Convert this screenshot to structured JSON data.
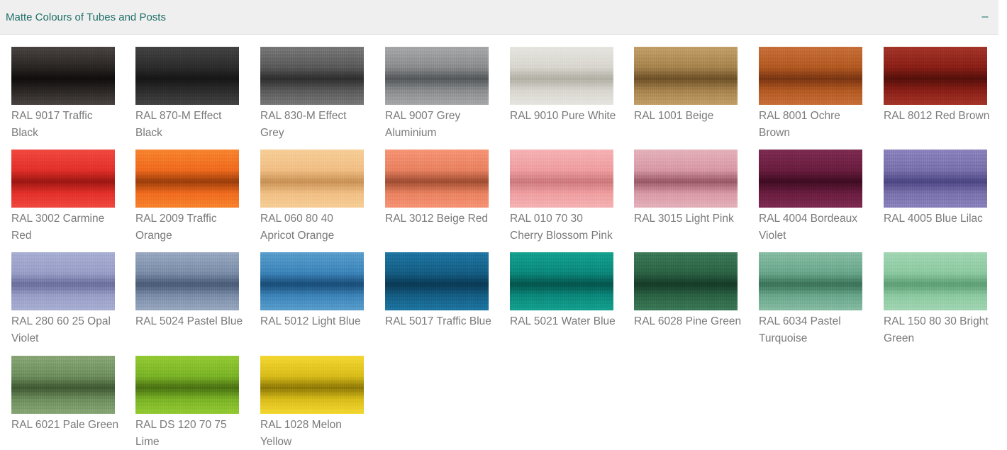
{
  "accordion": {
    "title": "Matte Colours of Tubes and Posts",
    "collapse_symbol": "–"
  },
  "swatches": [
    {
      "label": "RAL 9017 Traffic Black",
      "base": "#2a2624",
      "light": "#4a4542",
      "dark": "#100d0c",
      "icon": "color-swatch"
    },
    {
      "label": "RAL 870-M Effect Black",
      "base": "#2c2c2c",
      "light": "#444444",
      "dark": "#161616",
      "icon": "color-swatch"
    },
    {
      "label": "RAL 830-M Effect Grey",
      "base": "#5a5a5a",
      "light": "#7a7a7a",
      "dark": "#2e2e2e",
      "icon": "color-swatch"
    },
    {
      "label": "RAL 9007 Grey Aluminium",
      "base": "#8b8d8f",
      "light": "#a7a9ab",
      "dark": "#55585b",
      "icon": "color-swatch"
    },
    {
      "label": "RAL 9010 Pure White",
      "base": "#d8d6cf",
      "light": "#e6e5df",
      "dark": "#b3b0a5",
      "icon": "color-swatch"
    },
    {
      "label": "RAL 1001 Beige",
      "base": "#a7844e",
      "light": "#c3a06a",
      "dark": "#6e5127",
      "icon": "color-swatch"
    },
    {
      "label": "RAL 8001 Ochre Brown",
      "base": "#b35a22",
      "light": "#c8713a",
      "dark": "#7a3512",
      "icon": "color-swatch"
    },
    {
      "label": "RAL 8012 Red Brown",
      "base": "#8a1f16",
      "light": "#a5352a",
      "dark": "#55100b",
      "icon": "color-swatch"
    },
    {
      "label": "RAL 3002 Carmine Red",
      "base": "#e3302a",
      "light": "#f04a40",
      "dark": "#9d1712",
      "icon": "color-swatch"
    },
    {
      "label": "RAL 2009 Traffic Orange",
      "base": "#f06c1e",
      "light": "#f7862f",
      "dark": "#9c3e0b",
      "icon": "color-swatch"
    },
    {
      "label": "RAL 060 80 40 Apricot Orange",
      "base": "#f1bf86",
      "light": "#f6cf98",
      "dark": "#c99356",
      "icon": "color-swatch"
    },
    {
      "label": "RAL 3012 Beige Red",
      "base": "#e98361",
      "light": "#f69577",
      "dark": "#a04e33",
      "icon": "color-swatch"
    },
    {
      "label": "RAL 010 70 30 Cherry Blossom Pink",
      "base": "#ef9fa1",
      "light": "#f5b3b4",
      "dark": "#cd7b7e",
      "icon": "color-swatch"
    },
    {
      "label": "RAL 3015 Light Pink",
      "base": "#d89aa7",
      "light": "#e4b2bb",
      "dark": "#9a5b68",
      "icon": "color-swatch"
    },
    {
      "label": "RAL 4004 Bordeaux Violet",
      "base": "#6b1d40",
      "light": "#7e2c52",
      "dark": "#3f0c22",
      "icon": "color-swatch"
    },
    {
      "label": "RAL 4005 Blue Lilac",
      "base": "#7a72ac",
      "light": "#8c84bd",
      "dark": "#4d4785",
      "icon": "color-swatch"
    },
    {
      "label": "RAL 280 60 25 Opal Violet",
      "base": "#9aa0c8",
      "light": "#a9afd2",
      "dark": "#6b719c",
      "icon": "color-swatch"
    },
    {
      "label": "RAL 5024 Pastel Blue",
      "base": "#7d8faa",
      "light": "#9aa9c1",
      "dark": "#4a5c78",
      "icon": "color-swatch"
    },
    {
      "label": "RAL 5012 Light Blue",
      "base": "#3d86ba",
      "light": "#5a9fcc",
      "dark": "#194d79",
      "icon": "color-swatch"
    },
    {
      "label": "RAL 5017 Traffic Blue",
      "base": "#155f86",
      "light": "#1e77a3",
      "dark": "#0a3a55",
      "icon": "color-swatch"
    },
    {
      "label": "RAL 5021 Water Blue",
      "base": "#0b8a7d",
      "light": "#14a291",
      "dark": "#05554d",
      "icon": "color-swatch"
    },
    {
      "label": "RAL 6028 Pine Green",
      "base": "#2c6445",
      "light": "#3c7a58",
      "dark": "#163b28",
      "icon": "color-swatch"
    },
    {
      "label": "RAL 6034 Pastel Turquoise",
      "base": "#6ba88d",
      "light": "#88bda4",
      "dark": "#3b7459",
      "icon": "color-swatch"
    },
    {
      "label": "RAL 150 80 30 Bright Green",
      "base": "#8ecaa2",
      "light": "#a2d6b3",
      "dark": "#5f9f76",
      "icon": "color-swatch"
    },
    {
      "label": "RAL 6021 Pale Green",
      "base": "#6f8f5e",
      "light": "#8aa877",
      "dark": "#3f5a33",
      "icon": "color-swatch"
    },
    {
      "label": "RAL DS 120 70 75 Lime",
      "base": "#7cb427",
      "light": "#95cb34",
      "dark": "#4a7212",
      "icon": "color-swatch"
    },
    {
      "label": "RAL 1028 Melon Yellow",
      "base": "#d9bd1a",
      "light": "#f4d832",
      "dark": "#8f7a06",
      "icon": "color-swatch"
    }
  ]
}
